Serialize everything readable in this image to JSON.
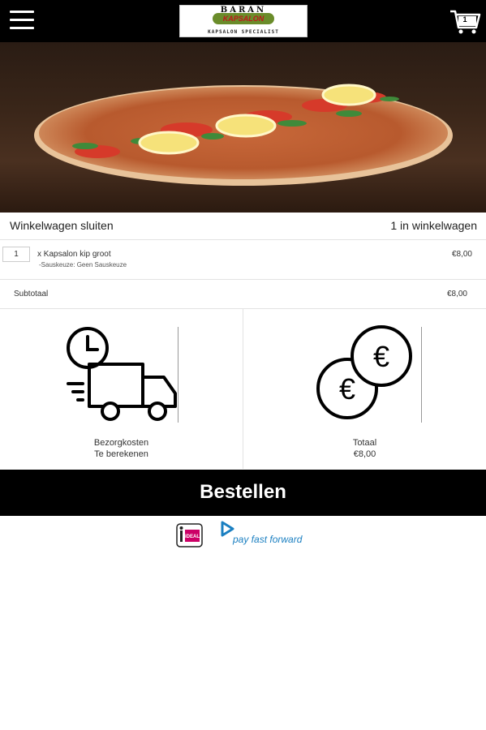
{
  "header": {
    "menu_icon": "hamburger-menu-icon",
    "logo": {
      "line1": "BARAN",
      "line2": "KAPSALON",
      "line3": "KAPSALON SPECIALIST"
    },
    "cart_icon": "shopping-cart-icon",
    "cart_badge": "1"
  },
  "hero": {
    "image": "lahmacun-pizza-photo"
  },
  "cart": {
    "close_label": "Winkelwagen sluiten",
    "count_label": "1 in winkelwagen",
    "items": [
      {
        "qty": "1",
        "name": "x Kapsalon kip groot",
        "option": "-Sauskeuze: Geen Sauskeuze",
        "price": "€8,00"
      }
    ],
    "subtotal_label": "Subtotaal",
    "subtotal_value": "€8,00"
  },
  "summary": {
    "delivery": {
      "icon": "delivery-truck-clock-icon",
      "label": "Bezorgkosten",
      "value": "Te berekenen"
    },
    "total": {
      "icon": "euro-coins-icon",
      "label": "Totaal",
      "value": "€8,00"
    }
  },
  "order_button": "Bestellen",
  "payment": {
    "ideal_icon": "ideal-logo",
    "ideal_text": "iDEAL",
    "ppff_icon": "pay-fast-forward-logo",
    "ppff_text": "pay fast forward"
  },
  "colors": {
    "bar": "#000000",
    "background": "#ffffff",
    "ideal_pink": "#cc0066",
    "ppff_blue": "#1a7fc1"
  }
}
